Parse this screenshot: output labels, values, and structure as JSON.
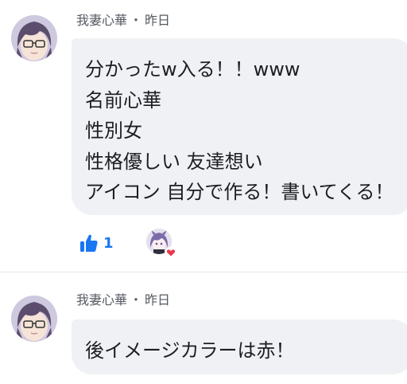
{
  "posts": [
    {
      "author": "我妻心華",
      "separator": "・",
      "time": "昨日",
      "lines": [
        "分かったw入る！！www",
        "名前心華",
        "性別女",
        "性格優しい 友達想い",
        "アイコン 自分で作る！書いてくる！"
      ],
      "reactions": {
        "like_icon": "thumbs-up-icon",
        "like_count": "1",
        "reactor_reaction": "heart-icon"
      }
    },
    {
      "author": "我妻心華",
      "separator": "・",
      "time": "昨日",
      "lines": [
        "後イメージカラーは赤！"
      ]
    }
  ],
  "colors": {
    "like_blue": "#1877f2",
    "heart_red": "#e8384f",
    "bubble_bg": "#f0f1f4",
    "meta_text": "#555a61"
  }
}
